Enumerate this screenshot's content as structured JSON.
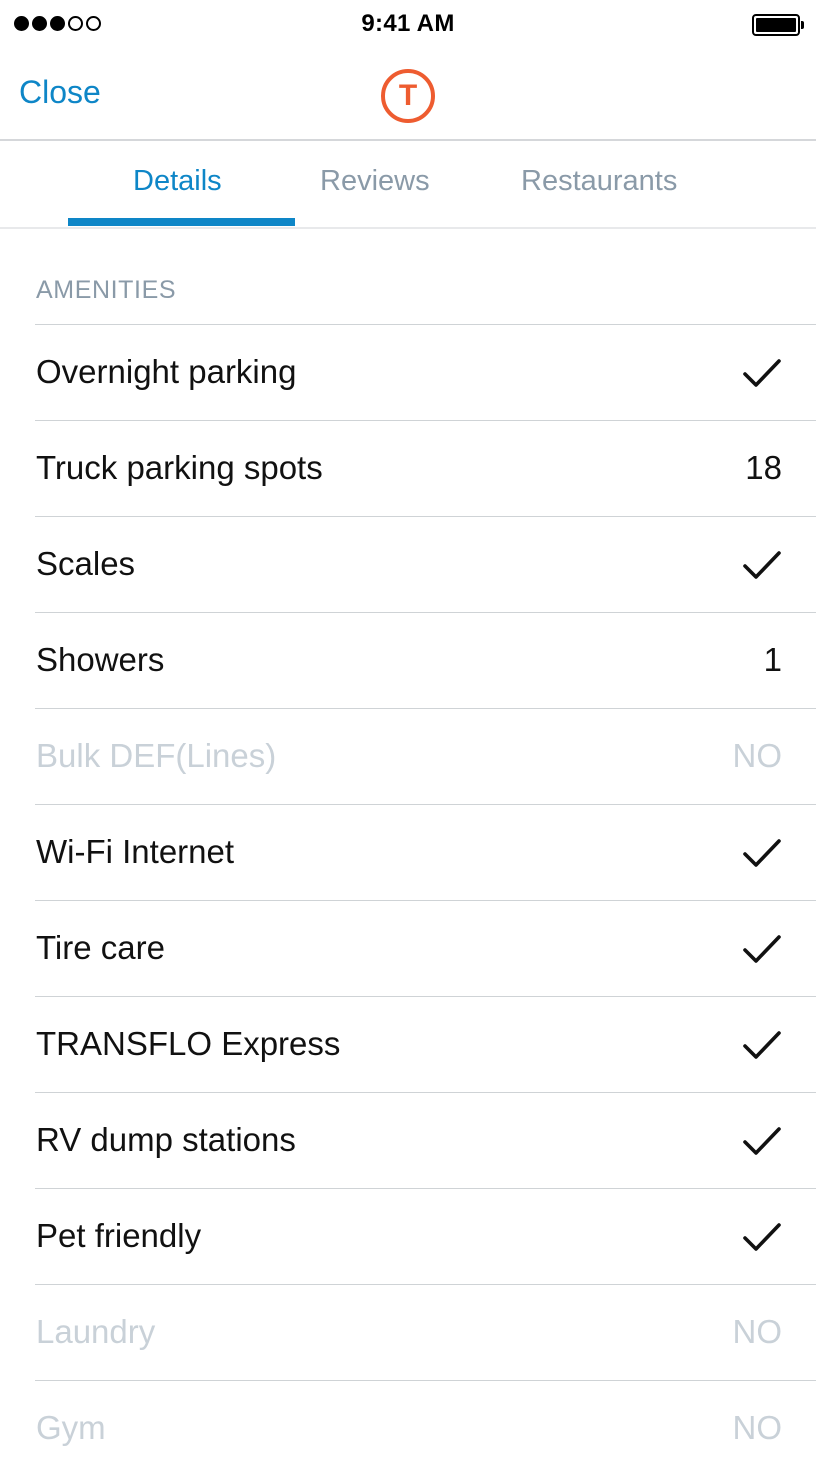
{
  "status_bar": {
    "time": "9:41 AM",
    "signal_bars_filled": 3,
    "signal_bars_total": 5,
    "battery_level": 1.0
  },
  "nav": {
    "close_label": "Close",
    "logo_letter": "T",
    "logo_color": "#ee5c30",
    "accent_color": "#0e86c7"
  },
  "tabs": [
    {
      "label": "Details",
      "active": true
    },
    {
      "label": "Reviews",
      "active": false
    },
    {
      "label": "Restaurants",
      "active": false
    }
  ],
  "amenities": {
    "header": "AMENITIES",
    "items": [
      {
        "label": "Overnight parking",
        "value": "",
        "icon": "checkmark-icon",
        "available": true
      },
      {
        "label": "Truck parking spots",
        "value": "18",
        "icon": "",
        "available": true
      },
      {
        "label": "Scales",
        "value": "",
        "icon": "checkmark-icon",
        "available": true
      },
      {
        "label": "Showers",
        "value": "1",
        "icon": "",
        "available": true
      },
      {
        "label": "Bulk DEF(Lines)",
        "value": "NO",
        "icon": "",
        "available": false
      },
      {
        "label": "Wi-Fi Internet",
        "value": "",
        "icon": "checkmark-icon",
        "available": true
      },
      {
        "label": "Tire care",
        "value": "",
        "icon": "checkmark-icon",
        "available": true
      },
      {
        "label": "TRANSFLO Express",
        "value": "",
        "icon": "checkmark-icon",
        "available": true
      },
      {
        "label": "RV dump stations",
        "value": "",
        "icon": "checkmark-icon",
        "available": true
      },
      {
        "label": "Pet friendly",
        "value": "",
        "icon": "checkmark-icon",
        "available": true
      },
      {
        "label": "Laundry",
        "value": "NO",
        "icon": "",
        "available": false
      },
      {
        "label": "Gym",
        "value": "NO",
        "icon": "",
        "available": false
      }
    ]
  }
}
